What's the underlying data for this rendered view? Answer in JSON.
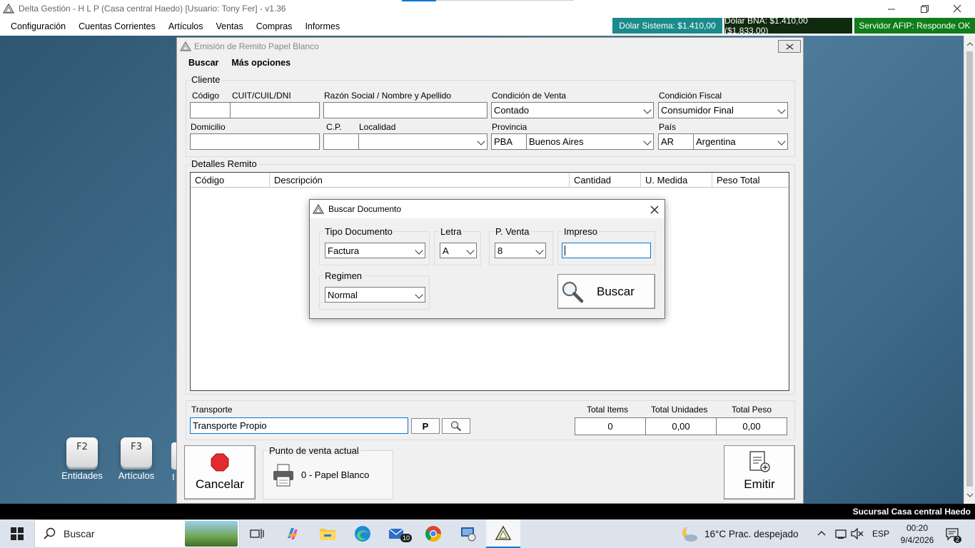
{
  "window": {
    "title": "Delta Gestión - H L P (Casa central Haedo) [Usuario: Tony Fer] - v1.36"
  },
  "menu": [
    "Configuración",
    "Cuentas Corrientes",
    "Artículos",
    "Ventas",
    "Compras",
    "Informes"
  ],
  "status": {
    "dolar_sistema": "Dólar Sistema: $1.410,00",
    "dolar_bna": "Dólar BNA: $1.410,00 ($1.833,00)",
    "afip": "Servidor AFIP:  Responde OK",
    "colors": {
      "dolar_sistema": "#1a8a8a",
      "dolar_bna": "#0f2a0f",
      "afip": "#0e7d1a"
    }
  },
  "desktop_shortcuts": [
    {
      "key": "F2",
      "label": "Entidades"
    },
    {
      "key": "F3",
      "label": "Artículos"
    }
  ],
  "form": {
    "title": "Emisión de Remito Papel Blanco",
    "links": {
      "buscar": "Buscar",
      "mas_opciones": "Más opciones"
    },
    "cliente": {
      "group": "Cliente",
      "codigo_label": "Código",
      "cuit_label": "CUIT/CUIL/DNI",
      "razon_label": "Razón Social / Nombre y Apellido",
      "cond_venta_label": "Condición de Venta",
      "cond_venta_value": "Contado",
      "cond_fiscal_label": "Condición Fiscal",
      "cond_fiscal_value": "Consumidor Final",
      "domicilio_label": "Domicilio",
      "cp_label": "C.P.",
      "localidad_label": "Localidad",
      "provincia_label": "Provincia",
      "provincia_code": "PBA",
      "provincia_value": "Buenos Aires",
      "pais_label": "País",
      "pais_code": "AR",
      "pais_value": "Argentina"
    },
    "detalles": {
      "group": "Detalles Remito",
      "columns": [
        "Código",
        "Descripción",
        "Cantidad",
        "U. Medida",
        "Peso Total"
      ]
    },
    "transporte": {
      "label": "Transporte",
      "value": "Transporte Propio",
      "p_button": "P"
    },
    "totales": {
      "items_label": "Total Items",
      "items_value": "0",
      "unidades_label": "Total Unidades",
      "unidades_value": "0,00",
      "peso_label": "Total Peso",
      "peso_value": "0,00"
    },
    "cancelar": "Cancelar",
    "punto_venta_group": "Punto de venta actual",
    "punto_venta_value": "0 - Papel Blanco",
    "emitir": "Emitir"
  },
  "dialog": {
    "title": "Buscar Documento",
    "tipo_label": "Tipo Documento",
    "tipo_value": "Factura",
    "letra_label": "Letra",
    "letra_value": "A",
    "pventa_label": "P. Venta",
    "pventa_value": "8",
    "impreso_label": "Impreso",
    "impreso_value": "",
    "regimen_label": "Regimen",
    "regimen_value": "Normal",
    "buscar_button": "Buscar"
  },
  "statusline": "Sucursal Casa central Haedo",
  "taskbar": {
    "search_placeholder": "Buscar",
    "mail_badge": "10",
    "weather": "16°C  Prac. despejado",
    "lang": "ESP",
    "time": "00:20",
    "date": "9/4/2026",
    "notif_count": "2"
  }
}
